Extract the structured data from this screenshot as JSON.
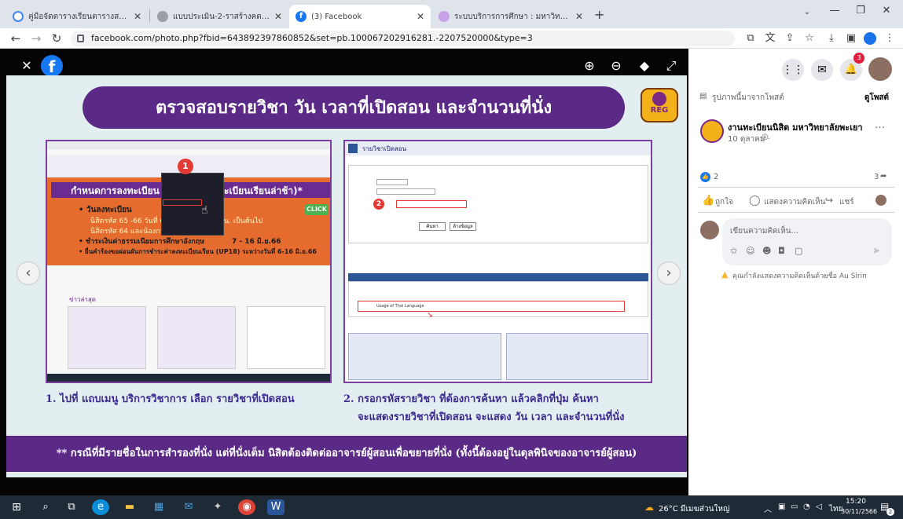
{
  "browser": {
    "tabs": [
      {
        "title": "คู่มือจัดตารางเรียนตารางสอนฯ/มหา...",
        "icon": "google-icon",
        "active": false
      },
      {
        "title": "แบบประเมิน-2-ราสร้างคตรา.pdf",
        "icon": "globe-icon",
        "active": false
      },
      {
        "title": "(3) Facebook",
        "icon": "facebook-icon",
        "active": true
      },
      {
        "title": "ระบบบริการการศึกษา : มหาวิทยาลัยพ...",
        "icon": "university-icon",
        "active": false
      }
    ],
    "new_tab": "+",
    "url": "facebook.com/photo.php?fbid=643892397860852&set=pb.100067202916281.-2207520000&type=3"
  },
  "viewer": {
    "close": "✕",
    "slide_title": "ตรวจสอบรายวิชา วัน เวลาที่เปิดสอน และจำนวนที่นั่ง",
    "reg_logo": "REG",
    "step1_caption": "1. ไปที่ แถบเมนู บริการวิชาการ เลือก รายวิชาที่เปิดสอน",
    "step2_caption_line1": "2. กรอกรหัสรายวิชา ที่ต้องการค้นหา แล้วคลิกที่ปุ่ม ค้นหา",
    "step2_caption_line2": "จะแสดงรายวิชาที่เปิดสอน จะแสดง วัน เวลา และจำนวนที่นั่ง",
    "footer_note": "** กรณีที่มีรายชื่อในการสำรองที่นั่ง แต่ที่นั่งเต็ม นิสิตต้องติดต่ออาจารย์ผู้สอนเพื่อขยายที่นั่ง (ทั้งนี้ต้องอยู่ในดุลพินิจของอาจารย์ผู้สอน)",
    "shot1": {
      "heading": "กำหนดการลงทะเบียน",
      "heading_tail": "ะเบียนเรียนล่าช้า)*",
      "bullet1": "• วันลงทะเบียน",
      "line1": "นิสิตรหัส 65 -66  วันที่ 6 -",
      "line1b": "น. เป็นต้นไป",
      "line2": "นิสิตรหัส 64 และน้องกว่า",
      "bullet2": "• ชำระเงินค่าธรรมเนียมการศึกษาอังกฤษ",
      "bullet2b": "7 - 16 มิ.ย.66",
      "bullet3": "• ยื่นคำร้องขอผ่อนผันการชำระค่าลงทะเบียนเรียน (UP18) ระหว่างวันที่ 6-16 มิ.ย.66",
      "click": "CLICK",
      "news": "ข่าวล่าสุด",
      "marker": "1"
    },
    "shot2": {
      "header": "รายวิชาเปิดสอน",
      "marker": "2",
      "search_btn": "ค้นหา",
      "reset_btn": "ล้างข้อมูล",
      "course_name": "Usage of Thai Language"
    }
  },
  "facebook": {
    "notifications": "3",
    "photo_from_post": "รูปภาพนี้มาจากโพสต์",
    "view_post": "ดูโพสต์",
    "page_name": "งานทะเบียนนิสิต มหาวิทยาลัยพะเยา",
    "post_date": "10 ตุลาคม · ",
    "reaction_count": "2",
    "share_count": "3",
    "like_label": "ถูกใจ",
    "comment_label": "แสดงความคิดเห็น",
    "share_label": "แชร์",
    "comment_placeholder": "เขียนความคิดเห็น...",
    "comment_notice": "คุณกำลังแสดงความคิดเห็นด้วยชื่อ Au Sirin"
  },
  "taskbar": {
    "weather": "26°C  มีเมฆส่วนใหญ่",
    "lang": "ไทย",
    "time": "15:20",
    "date": "30/11/2566",
    "notif_count": "2"
  },
  "colors": {
    "accent": "#1877f2",
    "slide_purple": "#5b2a86",
    "tab_bg": "#dfe3ea"
  }
}
